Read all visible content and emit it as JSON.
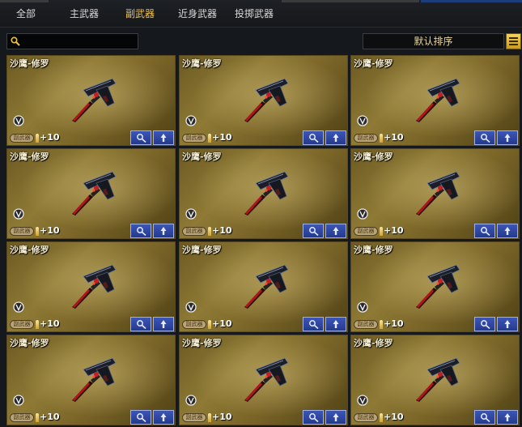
{
  "tabs": [
    {
      "label": "全部",
      "active": false
    },
    {
      "label": "主武器",
      "active": false
    },
    {
      "label": "副武器",
      "active": true
    },
    {
      "label": "近身武器",
      "active": false
    },
    {
      "label": "投掷武器",
      "active": false
    }
  ],
  "search": {
    "icon": "search-icon"
  },
  "sort": {
    "label": "默认排序"
  },
  "colors": {
    "active_tab": "#f2c14a",
    "card_gold": "#8e7a35",
    "button_blue": "#2f48a2"
  },
  "cards": [
    {
      "name": "沙鹰-修罗",
      "tag": "副武器",
      "level": "+10"
    },
    {
      "name": "沙鹰-修罗",
      "tag": "副武器",
      "level": "+10"
    },
    {
      "name": "沙鹰-修罗",
      "tag": "副武器",
      "level": "+10"
    },
    {
      "name": "沙鹰-修罗",
      "tag": "副武器",
      "level": "+10"
    },
    {
      "name": "沙鹰-修罗",
      "tag": "副武器",
      "level": "+10"
    },
    {
      "name": "沙鹰-修罗",
      "tag": "副武器",
      "level": "+10"
    },
    {
      "name": "沙鹰-修罗",
      "tag": "副武器",
      "level": "+10"
    },
    {
      "name": "沙鹰-修罗",
      "tag": "副武器",
      "level": "+10"
    },
    {
      "name": "沙鹰-修罗",
      "tag": "副武器",
      "level": "+10"
    },
    {
      "name": "沙鹰-修罗",
      "tag": "副武器",
      "level": "+10"
    },
    {
      "name": "沙鹰-修罗",
      "tag": "副武器",
      "level": "+10"
    },
    {
      "name": "沙鹰-修罗",
      "tag": "副武器",
      "level": "+10"
    }
  ]
}
